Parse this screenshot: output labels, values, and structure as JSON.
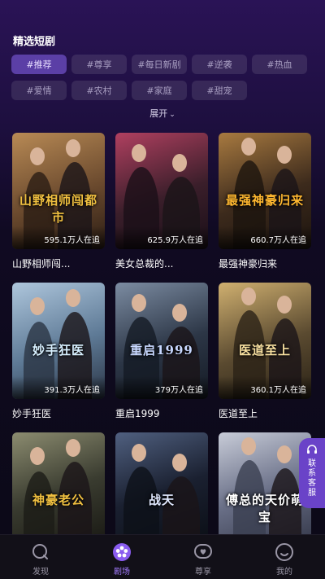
{
  "section_title": "精选短剧",
  "tags": [
    "#推荐",
    "#尊享",
    "#每日新剧",
    "#逆袭",
    "#热血",
    "#爱情",
    "#农村",
    "#家庭",
    "#甜宠"
  ],
  "active_tag_index": 0,
  "expand_label": "展开",
  "dramas": [
    {
      "title": "山野相师闯...",
      "views": "595.1万人在追",
      "poster_text": "山野相师闯都市",
      "palette": [
        "#6b4a2e",
        "#b88a55",
        "#2b1d14"
      ],
      "accent": "#f0c040"
    },
    {
      "title": "美女总裁的...",
      "views": "625.9万人在追",
      "poster_text": "",
      "palette": [
        "#3a1e2a",
        "#b04060",
        "#1a0f18"
      ],
      "accent": "#e03050"
    },
    {
      "title": "最强神豪归来",
      "views": "660.7万人在追",
      "poster_text": "最强神豪归来",
      "palette": [
        "#3c2a1c",
        "#a87a40",
        "#1c140e"
      ],
      "accent": "#ffb830"
    },
    {
      "title": "妙手狂医",
      "views": "391.3万人在追",
      "poster_text": "妙手狂医",
      "palette": [
        "#5e7a96",
        "#aec6dc",
        "#2a3444"
      ],
      "accent": "#d8f0ff"
    },
    {
      "title": "重启1999",
      "views": "379万人在追",
      "poster_text": "重启1999",
      "palette": [
        "#2c3646",
        "#7c8ca2",
        "#141a24"
      ],
      "accent": "#c8d8ff"
    },
    {
      "title": "医道至上",
      "views": "360.1万人在追",
      "poster_text": "医道至上",
      "palette": [
        "#5a4a30",
        "#d0b070",
        "#2a2216"
      ],
      "accent": "#f8e0a0"
    },
    {
      "title": "",
      "views": "",
      "poster_text": "神豪老公",
      "palette": [
        "#3a3c30",
        "#8c8c70",
        "#1c1c16"
      ],
      "accent": "#f0c040"
    },
    {
      "title": "",
      "views": "",
      "poster_text": "战天",
      "palette": [
        "#1a2030",
        "#506080",
        "#0c1018"
      ],
      "accent": "#e0e8ff"
    },
    {
      "title": "",
      "views": "",
      "poster_text": "傅总的天价萌宝",
      "palette": [
        "#6a7088",
        "#c8ccd8",
        "#3a3e50"
      ],
      "accent": "#ffffff"
    }
  ],
  "side_service_label": "联系客服",
  "tabbar": [
    {
      "label": "发现",
      "icon": "discover-icon"
    },
    {
      "label": "剧场",
      "icon": "theater-icon"
    },
    {
      "label": "尊享",
      "icon": "heart-bubble-icon"
    },
    {
      "label": "我的",
      "icon": "profile-icon"
    }
  ],
  "active_tab_index": 1
}
